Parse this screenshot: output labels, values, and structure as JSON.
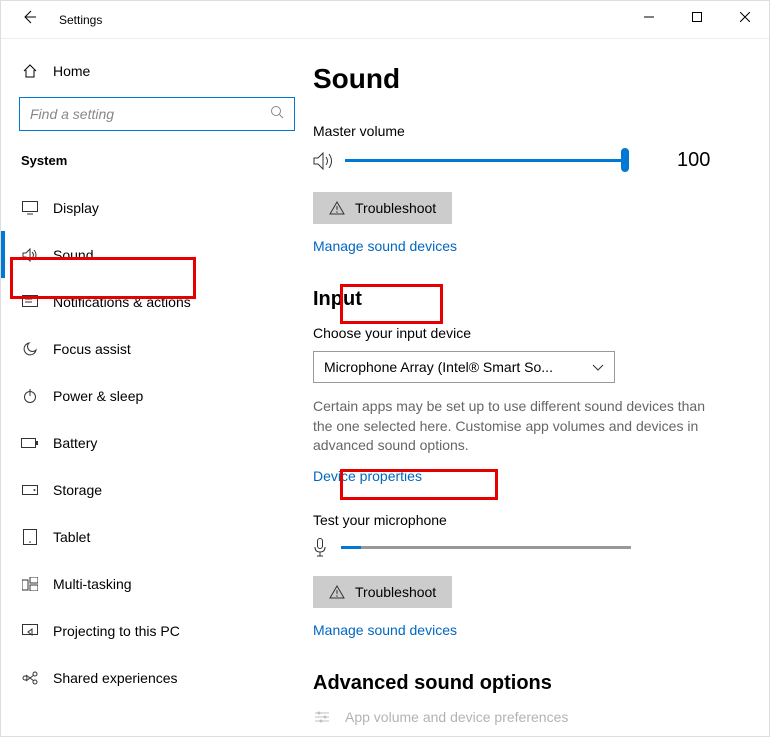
{
  "titlebar": {
    "title": "Settings"
  },
  "sidebar": {
    "home": "Home",
    "search_placeholder": "Find a setting",
    "group": "System",
    "items": [
      {
        "label": "Display"
      },
      {
        "label": "Sound"
      },
      {
        "label": "Notifications & actions"
      },
      {
        "label": "Focus assist"
      },
      {
        "label": "Power & sleep"
      },
      {
        "label": "Battery"
      },
      {
        "label": "Storage"
      },
      {
        "label": "Tablet"
      },
      {
        "label": "Multi-tasking"
      },
      {
        "label": "Projecting to this PC"
      },
      {
        "label": "Shared experiences"
      }
    ]
  },
  "main": {
    "title": "Sound",
    "master_volume_label": "Master volume",
    "volume_value": "100",
    "troubleshoot": "Troubleshoot",
    "manage_devices": "Manage sound devices",
    "input_heading": "Input",
    "choose_input_label": "Choose your input device",
    "input_device": "Microphone Array (Intel® Smart So...",
    "input_help": "Certain apps may be set up to use different sound devices than the one selected here. Customise app volumes and devices in advanced sound options.",
    "device_properties": "Device properties",
    "test_mic_label": "Test your microphone",
    "advanced_heading": "Advanced sound options",
    "app_prefs": "App volume and device preferences"
  }
}
